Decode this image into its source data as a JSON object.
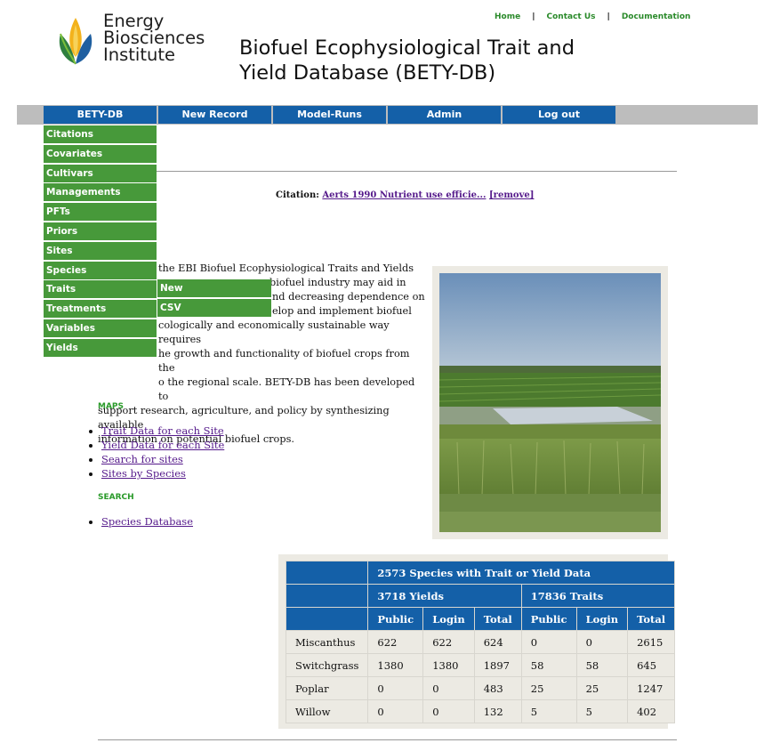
{
  "header": {
    "logo_lines": [
      "Energy",
      "Biosciences",
      "Institute"
    ],
    "title_line1": "Biofuel Ecophysiological Trait and",
    "title_line2": "Yield Database (BETY-DB)",
    "top_links": [
      "Home",
      "Contact Us",
      "Documentation"
    ]
  },
  "nav": {
    "items": [
      "BETY-DB",
      "New Record",
      "Model-Runs",
      "Admin",
      "Log out"
    ]
  },
  "dropdown": {
    "items": [
      "Citations",
      "Covariates",
      "Cultivars",
      "Managements",
      "PFTs",
      "Priors",
      "Sites",
      "Species",
      "Traits",
      "Treatments",
      "Variables",
      "Yields"
    ],
    "submenu": [
      "New",
      "CSV"
    ]
  },
  "citation": {
    "label": "Citation:",
    "link": "Aerts 1990 Nutrient use efficie...",
    "remove": "[remove]"
  },
  "intro": {
    "lines": [
      "the EBI Biofuel Ecophysiological Traits and Yields",
      "biofuel industry may aid in",
      "nd decreasing dependence on",
      "elop and implement biofuel",
      "cologically and economically sustainable way requires",
      "he growth and functionality of biofuel crops from the",
      "o the regional scale. BETY-DB has been developed to",
      "support research, agriculture, and policy by synthesizing available",
      "information on potential biofuel crops."
    ]
  },
  "maps": {
    "heading": "MAPS",
    "links": [
      "Trait Data for each Site",
      "Yield Data for each Site",
      "Search for sites",
      "Sites by Species"
    ]
  },
  "search": {
    "heading": "SEARCH",
    "links": [
      "Species Database"
    ]
  },
  "table": {
    "title": "2573 Species with Trait or Yield Data",
    "yields_header": "3718 Yields",
    "traits_header": "17836 Traits",
    "sub_headers": [
      "Public",
      "Login",
      "Total",
      "Public",
      "Login",
      "Total"
    ],
    "rows": [
      {
        "name": "Miscanthus",
        "cells": [
          "622",
          "622",
          "624",
          "0",
          "0",
          "2615"
        ]
      },
      {
        "name": "Switchgrass",
        "cells": [
          "1380",
          "1380",
          "1897",
          "58",
          "58",
          "645"
        ]
      },
      {
        "name": "Poplar",
        "cells": [
          "0",
          "0",
          "483",
          "25",
          "25",
          "1247"
        ]
      },
      {
        "name": "Willow",
        "cells": [
          "0",
          "0",
          "132",
          "5",
          "5",
          "402"
        ]
      }
    ]
  },
  "colors": {
    "nav_blue": "#1460a8",
    "menu_green": "#47993a",
    "link_purple": "#551a8b",
    "heading_green": "#2a9a2a"
  }
}
